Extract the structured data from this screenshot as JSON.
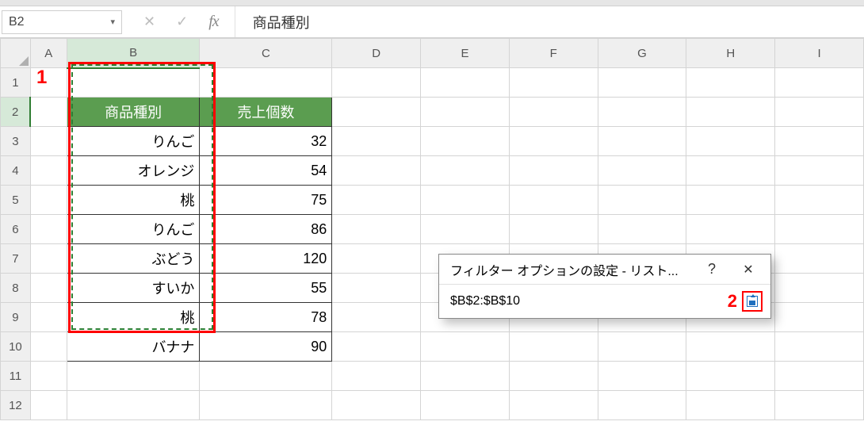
{
  "name_box": {
    "value": "B2"
  },
  "formula_bar": {
    "value": "商品種別"
  },
  "columns": [
    "A",
    "B",
    "C",
    "D",
    "E",
    "F",
    "G",
    "H",
    "I"
  ],
  "row_numbers": [
    1,
    2,
    3,
    4,
    5,
    6,
    7,
    8,
    9,
    10,
    11,
    12
  ],
  "selected_col_index": 1,
  "selected_row_index": 1,
  "table": {
    "headers": [
      "商品種別",
      "売上個数"
    ],
    "rows": [
      {
        "name": "りんご",
        "qty": 32
      },
      {
        "name": "オレンジ",
        "qty": 54
      },
      {
        "name": "桃",
        "qty": 75
      },
      {
        "name": "りんご",
        "qty": 86
      },
      {
        "name": "ぶどう",
        "qty": 120
      },
      {
        "name": "すいか",
        "qty": 55
      },
      {
        "name": "桃",
        "qty": 78
      },
      {
        "name": "バナナ",
        "qty": 90
      }
    ]
  },
  "annotations": {
    "label1": "1",
    "label2": "2"
  },
  "dialog": {
    "title": "フィルター オプションの設定 - リスト...",
    "help": "?",
    "close": "✕",
    "range": "$B$2:$B$10"
  }
}
